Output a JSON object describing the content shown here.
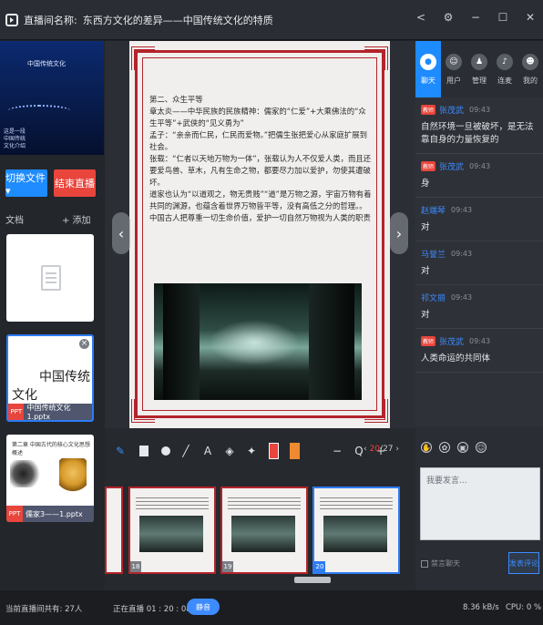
{
  "window": {
    "label": "直播间名称:",
    "title": "东西方文化的差异——中国传统文化的特质",
    "controls": [
      "share",
      "settings",
      "minimize",
      "maximize",
      "close"
    ]
  },
  "preview": {
    "title": "中国传统文化",
    "lines": [
      "这是一段",
      "中国传统",
      "文化介绍"
    ]
  },
  "left": {
    "switch_doc": "切换文件 ▾",
    "end_live": "结束直播",
    "doc_label": "文档",
    "add_label": "+ 添加",
    "files": [
      {
        "tag": "PPT",
        "name": "中国传统文化1.pptx",
        "title_a": "中国传统",
        "title_b": "文化"
      },
      {
        "tag": "PPT",
        "name": "儒家3——1.pptx",
        "header": "第二章 中国古代的核心文化思想概述"
      }
    ]
  },
  "slide": {
    "heading": "第二、众生平等",
    "paragraphs": [
      "章太炎——中华民族的民族精神：儒家的“仁爱”+大乘佛法的“众生平等”+武侠的“见义勇为”",
      "孟子：“亲亲而仁民，仁民而爱物。”把儒生张把爱心从家庭扩展到社会。",
      "张载：“仁者以天地万物为一体”，张载认为人不仅爱人类，而且还要爱鸟兽、草木，凡有生命之物，都要尽力加以爱护，勿使其遭破坏。",
      "道家也认为“以道观之，物无贵贱”“道”是万物之源，宇宙万物有着共同的渊源，也蕴含着世界万物皆平等，没有高低之分的哲理。。",
      "中国古人把尊重一切生命价值，爱护一切自然万物视为人类的职责"
    ]
  },
  "toolbar": {
    "tools": [
      "pen-icon",
      "rect-icon",
      "circle-icon",
      "line-icon",
      "text-icon",
      "eraser-icon",
      "clear-icon"
    ],
    "text_tool": "A",
    "colors": [
      "#e8453c",
      "#f08a30"
    ],
    "zoom_out": "−",
    "zoom_icon": "Q",
    "zoom_in": "+",
    "page_current": "20",
    "page_total": "/27",
    "prev": "‹",
    "next": "›"
  },
  "filmstrip": [
    {
      "num": "18"
    },
    {
      "num": "19"
    },
    {
      "num": "20",
      "selected": true
    }
  ],
  "right": {
    "tabs": [
      {
        "label": "聊天",
        "icon": "chat-icon",
        "active": true
      },
      {
        "label": "用户",
        "icon": "users-icon"
      },
      {
        "label": "管理",
        "icon": "manage-icon"
      },
      {
        "label": "连麦",
        "icon": "mic-icon"
      },
      {
        "label": "我的",
        "icon": "me-icon"
      }
    ],
    "messages": [
      {
        "badge": "教师",
        "name": "张茂武",
        "time": "09:43",
        "text": "自然环境一旦被破坏，是无法靠自身的力量恢复的"
      },
      {
        "badge": "教师",
        "name": "张茂武",
        "time": "09:43",
        "text": "身"
      },
      {
        "badge": "",
        "name": "赵端琴",
        "time": "09:43",
        "text": "对"
      },
      {
        "badge": "",
        "name": "马誉兰",
        "time": "09:43",
        "text": "对"
      },
      {
        "badge": "",
        "name": "祁文丽",
        "time": "09:43",
        "text": "对"
      },
      {
        "badge": "教师",
        "name": "张茂武",
        "time": "09:43",
        "text": "人类命运的共同体"
      }
    ],
    "input_placeholder": "我要发言...",
    "forbid_label": "禁言聊天",
    "send_label": "发表评论"
  },
  "status": {
    "users": "当前直播间共有: 27人",
    "live_time": "正在直播 01 : 20 : 08",
    "mute": "静音",
    "rate": "8.36 kB/s",
    "cpu": "CPU: 0 %"
  },
  "colors": {
    "accent": "#1e8bff",
    "danger": "#e8453c",
    "slide_border": "#b3242c"
  }
}
